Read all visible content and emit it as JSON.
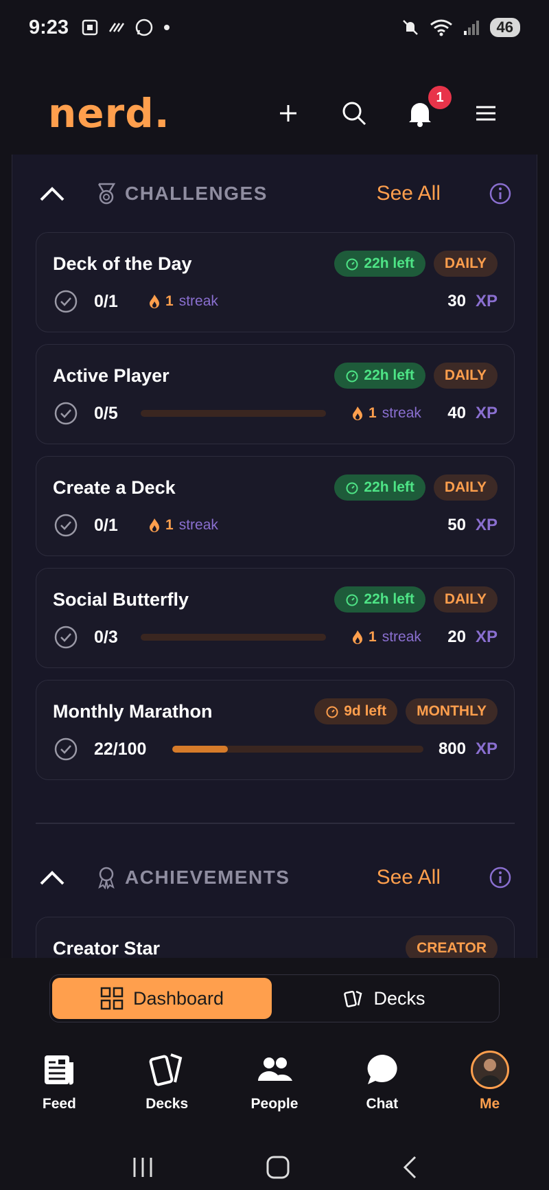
{
  "status_bar": {
    "time": "9:23",
    "battery": "46",
    "signal_label": "6"
  },
  "header": {
    "logo": "nerd.",
    "notification_count": "1"
  },
  "challenges": {
    "title": "CHALLENGES",
    "see_all": "See All",
    "items": [
      {
        "title": "Deck of the Day",
        "time_left": "22h left",
        "period": "DAILY",
        "progress": "0/1",
        "streak_count": "1",
        "streak_word": "streak",
        "xp": "30",
        "xp_unit": "XP"
      },
      {
        "title": "Active Player",
        "time_left": "22h left",
        "period": "DAILY",
        "progress": "0/5",
        "progress_fraction": 0,
        "streak_count": "1",
        "streak_word": "streak",
        "xp": "40",
        "xp_unit": "XP"
      },
      {
        "title": "Create a Deck",
        "time_left": "22h left",
        "period": "DAILY",
        "progress": "0/1",
        "streak_count": "1",
        "streak_word": "streak",
        "xp": "50",
        "xp_unit": "XP"
      },
      {
        "title": "Social Butterfly",
        "time_left": "22h left",
        "period": "DAILY",
        "progress": "0/3",
        "progress_fraction": 0,
        "streak_count": "1",
        "streak_word": "streak",
        "xp": "20",
        "xp_unit": "XP"
      },
      {
        "title": "Monthly Marathon",
        "time_left": "9d left",
        "period": "MONTHLY",
        "progress": "22/100",
        "progress_fraction": 0.22,
        "xp": "800",
        "xp_unit": "XP"
      }
    ]
  },
  "achievements": {
    "title": "ACHIEVEMENTS",
    "see_all": "See All",
    "items": [
      {
        "title": "Creator Star",
        "category": "CREATOR"
      }
    ]
  },
  "view_toggle": {
    "dashboard": "Dashboard",
    "decks": "Decks"
  },
  "bottom_nav": {
    "feed": "Feed",
    "decks": "Decks",
    "people": "People",
    "chat": "Chat",
    "me": "Me"
  },
  "colors": {
    "accent": "#ff9f4d",
    "xp": "#8a6fd0",
    "time_green": "#4ee486"
  }
}
